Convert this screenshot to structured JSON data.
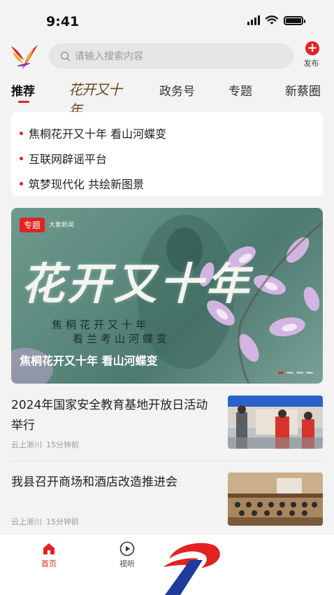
{
  "status": {
    "time": "9:41"
  },
  "header": {
    "search_placeholder": "请输入搜索内容",
    "publish_label": "发布"
  },
  "tabs": [
    {
      "label": "推荐",
      "active": true
    },
    {
      "label": "花开又十年",
      "type": "logo"
    },
    {
      "label": "政务号"
    },
    {
      "label": "专题"
    },
    {
      "label": "新蔡圈"
    }
  ],
  "headlines": [
    "焦桐花开又十年 看山河蝶变",
    "互联网辟谣平台",
    "筑梦现代化 共绘新图景"
  ],
  "banner": {
    "tag": "专题",
    "org_text": "大象新闻",
    "calligraphy": "花开又十年",
    "subtitle_line1": "焦桐花开又十年",
    "subtitle_line2": "看兰考山河蝶变",
    "caption": "焦桐花开又十年 看山河蝶变",
    "active_slide": 1,
    "slide_count": 4
  },
  "news": [
    {
      "title": "2024年国家安全教育基地开放日活动举行",
      "source": "云上淅川",
      "time": "15分钟前"
    },
    {
      "title": "我县召开商场和酒店改造推进会",
      "source": "云上淅川",
      "time": "15分钟前"
    }
  ],
  "tabbar": [
    {
      "label": "首页",
      "icon": "home-icon",
      "active": true
    },
    {
      "label": "视听",
      "icon": "play-icon",
      "active": false
    }
  ],
  "colors": {
    "accent": "#e32222",
    "background": "#f3f3f3"
  }
}
